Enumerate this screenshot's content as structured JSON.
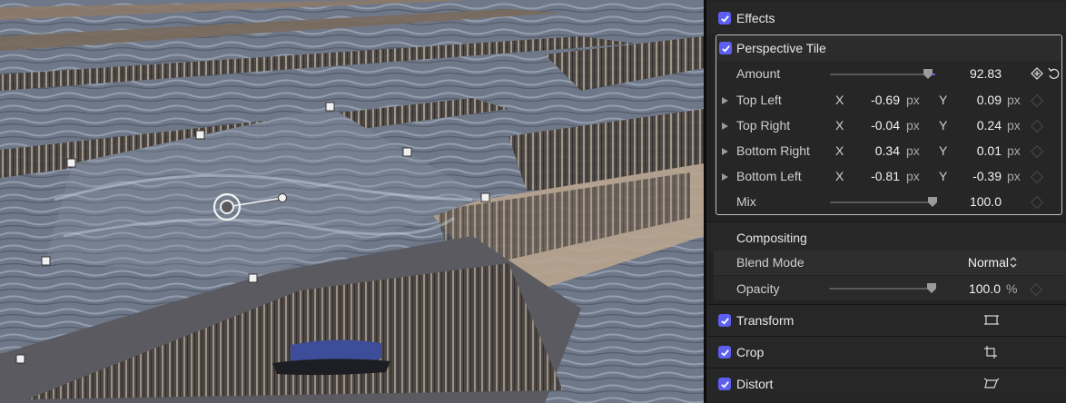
{
  "inspector": {
    "effects_label": "Effects",
    "perspective_tile": {
      "title": "Perspective Tile",
      "amount": {
        "label": "Amount",
        "value": "92.83",
        "fraction": 0.93
      },
      "corners": [
        {
          "label": "Top Left",
          "x_axis": "X",
          "x": "-0.69",
          "x_unit": "px",
          "y_axis": "Y",
          "y": "0.09",
          "y_unit": "px"
        },
        {
          "label": "Top Right",
          "x_axis": "X",
          "x": "-0.04",
          "x_unit": "px",
          "y_axis": "Y",
          "y": "0.24",
          "y_unit": "px"
        },
        {
          "label": "Bottom Right",
          "x_axis": "X",
          "x": "0.34",
          "x_unit": "px",
          "y_axis": "Y",
          "y": "0.01",
          "y_unit": "px"
        },
        {
          "label": "Bottom Left",
          "x_axis": "X",
          "x": "-0.81",
          "x_unit": "px",
          "y_axis": "Y",
          "y": "-0.39",
          "y_unit": "px"
        }
      ],
      "mix": {
        "label": "Mix",
        "value": "100.0",
        "fraction": 1.0
      }
    },
    "compositing": {
      "title": "Compositing",
      "blend_mode": {
        "label": "Blend Mode",
        "value": "Normal"
      },
      "opacity": {
        "label": "Opacity",
        "value": "100.0",
        "unit": "%",
        "fraction": 1.0
      }
    },
    "sections": [
      {
        "label": "Transform",
        "icon": "transform-icon"
      },
      {
        "label": "Crop",
        "icon": "crop-icon"
      },
      {
        "label": "Distort",
        "icon": "distort-icon"
      }
    ]
  },
  "colors": {
    "accent": "#5c5ff0",
    "panel": "#232323",
    "viewer_water": "#7d8594"
  }
}
